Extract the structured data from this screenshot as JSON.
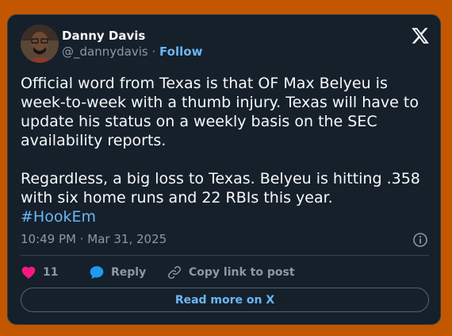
{
  "author": {
    "name": "Danny Davis",
    "handle": "@_dannydavis",
    "separator": "·",
    "follow_label": "Follow"
  },
  "tweet": {
    "paragraph1": "Official word from Texas is that OF Max Belyeu is week-to-week with a thumb injury. Texas will have to update his status on a weekly basis on the SEC availability reports.",
    "paragraph2": "Regardless, a big loss to Texas. Belyeu is hitting .358 with six home runs and 22 RBIs this year.",
    "hashtag": "#HookEm",
    "timestamp": "10:49 PM · Mar 31, 2025"
  },
  "actions": {
    "like_count": "11",
    "reply_label": "Reply",
    "copy_link_label": "Copy link to post"
  },
  "footer": {
    "read_more_label": "Read more on X"
  },
  "colors": {
    "page_background": "#c25700",
    "card_background": "#15202b",
    "accent_link": "#6cb6f2",
    "like_pink": "#f91880",
    "reply_blue": "#1d9bf0"
  },
  "icons": [
    "x-logo-icon",
    "info-icon",
    "heart-icon",
    "reply-bubble-icon",
    "link-icon"
  ]
}
